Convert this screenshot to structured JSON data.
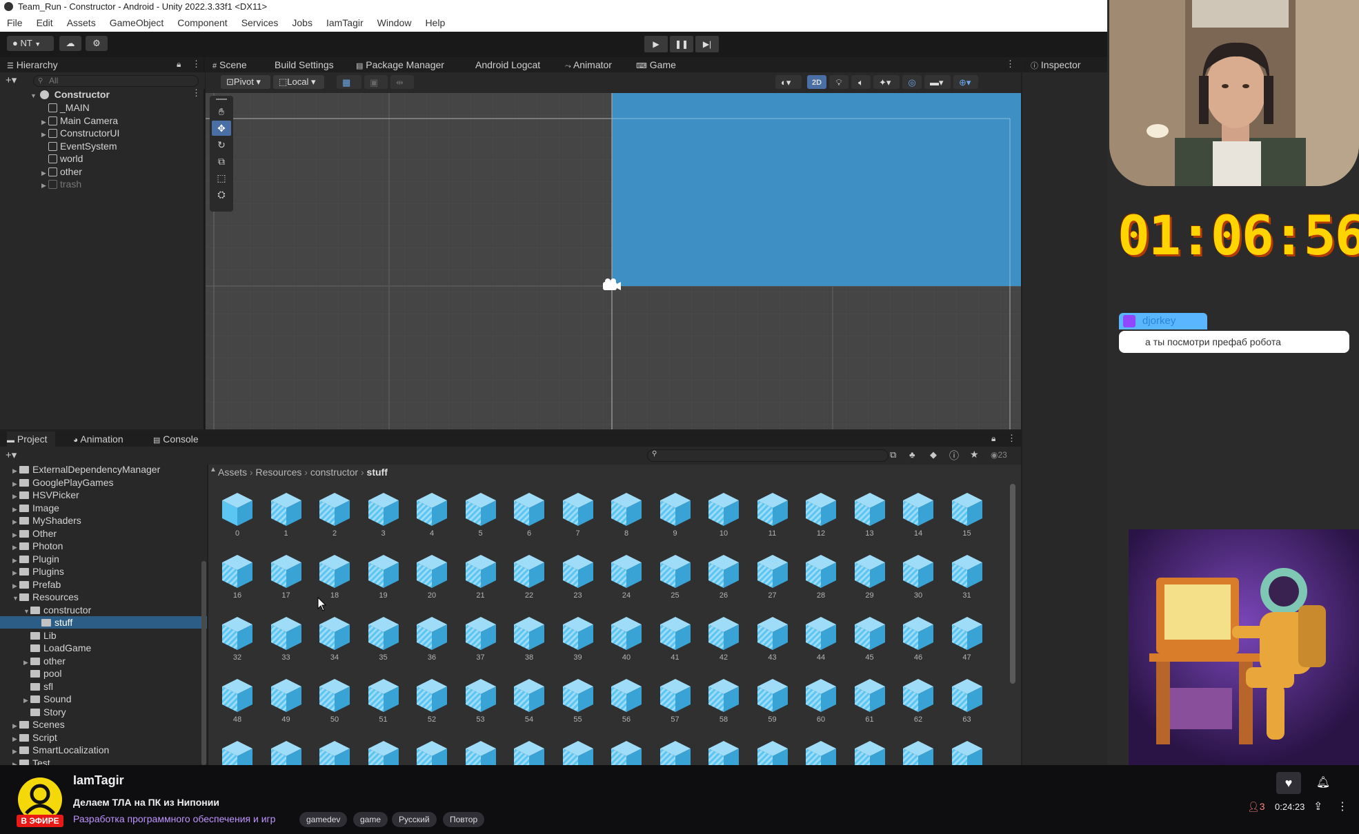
{
  "titlebar": {
    "text": "Team_Run - Constructor - Android - Unity 2022.3.33f1 <DX11>"
  },
  "menu": [
    "File",
    "Edit",
    "Assets",
    "GameObject",
    "Component",
    "Services",
    "Jobs",
    "IamTagir",
    "Window",
    "Help"
  ],
  "toolbar": {
    "account": "NT"
  },
  "hierarchy": {
    "tab": "Hierarchy",
    "search_placeholder": "All",
    "root": "Constructor",
    "items": [
      "_MAIN",
      "Main Camera",
      "ConstructorUI",
      "EventSystem",
      "world",
      "other",
      "trash"
    ]
  },
  "scene_tabs": [
    "Scene",
    "Build Settings",
    "Package Manager",
    "Android Logcat",
    "Animator",
    "Game"
  ],
  "scene_tools": {
    "pivot": "Pivot",
    "local": "Local",
    "mode_2d": "2D"
  },
  "inspector": {
    "tab": "Inspector"
  },
  "project_tabs": [
    "Project",
    "Animation",
    "Console"
  ],
  "project": {
    "hidden_count": "23",
    "breadcrumb": [
      "Assets",
      "Resources",
      "constructor",
      "stuff"
    ],
    "folders": [
      {
        "name": "ExternalDependencyManager",
        "depth": 1,
        "arrow": true
      },
      {
        "name": "GooglePlayGames",
        "depth": 1,
        "arrow": true
      },
      {
        "name": "HSVPicker",
        "depth": 1,
        "arrow": true
      },
      {
        "name": "Image",
        "depth": 1,
        "arrow": true
      },
      {
        "name": "MyShaders",
        "depth": 1,
        "arrow": true
      },
      {
        "name": "Other",
        "depth": 1,
        "arrow": true
      },
      {
        "name": "Photon",
        "depth": 1,
        "arrow": true
      },
      {
        "name": "Plugin",
        "depth": 1,
        "arrow": true
      },
      {
        "name": "Plugins",
        "depth": 1,
        "arrow": true
      },
      {
        "name": "Prefab",
        "depth": 1,
        "arrow": true
      },
      {
        "name": "Resources",
        "depth": 1,
        "arrow": "open"
      },
      {
        "name": "constructor",
        "depth": 2,
        "arrow": "open"
      },
      {
        "name": "stuff",
        "depth": 3,
        "arrow": false,
        "selected": true
      },
      {
        "name": "Lib",
        "depth": 2,
        "arrow": false
      },
      {
        "name": "LoadGame",
        "depth": 2,
        "arrow": false
      },
      {
        "name": "other",
        "depth": 2,
        "arrow": true
      },
      {
        "name": "pool",
        "depth": 2,
        "arrow": false
      },
      {
        "name": "sfl",
        "depth": 2,
        "arrow": false
      },
      {
        "name": "Sound",
        "depth": 2,
        "arrow": true
      },
      {
        "name": "Story",
        "depth": 2,
        "arrow": false
      },
      {
        "name": "Scenes",
        "depth": 1,
        "arrow": true
      },
      {
        "name": "Script",
        "depth": 1,
        "arrow": true
      },
      {
        "name": "SmartLocalization",
        "depth": 1,
        "arrow": true
      },
      {
        "name": "Test",
        "depth": 1,
        "arrow": true
      }
    ],
    "assets": [
      "0",
      "1",
      "2",
      "3",
      "4",
      "5",
      "6",
      "7",
      "8",
      "9",
      "10",
      "11",
      "12",
      "13",
      "14",
      "15",
      "16",
      "17",
      "18",
      "19",
      "20",
      "21",
      "22",
      "23",
      "24",
      "25",
      "26",
      "27",
      "28",
      "29",
      "30",
      "31",
      "32",
      "33",
      "34",
      "35",
      "36",
      "37",
      "38",
      "39",
      "40",
      "41",
      "42",
      "43",
      "44",
      "45",
      "46",
      "47",
      "48",
      "49",
      "50",
      "51",
      "52",
      "53",
      "54",
      "55",
      "56",
      "57",
      "58",
      "59",
      "60",
      "61",
      "62",
      "63",
      "",
      "",
      "",
      "",
      "",
      "",
      "",
      "",
      "",
      "",
      "",
      "",
      "",
      "",
      "",
      ""
    ]
  },
  "overlay": {
    "timer": "01:06:56",
    "chat_user": "djorkey",
    "chat_message": "а ты посмотри префаб робота"
  },
  "stream": {
    "channel": "IamTagir",
    "title": "Делаем ТЛА на ПК из Нипонии",
    "category": "Разработка программного обеспечения и игр",
    "live_badge": "В ЭФИРЕ",
    "tags": [
      "gamedev",
      "game",
      "Русский",
      "Повтор"
    ],
    "viewers": "3",
    "uptime": "0:24:23"
  },
  "colors": {
    "accent_blue": "#3d8fc4",
    "cube": "#5cc6f2",
    "selection": "#2c5d87",
    "twitch_purple": "#9146ff"
  }
}
